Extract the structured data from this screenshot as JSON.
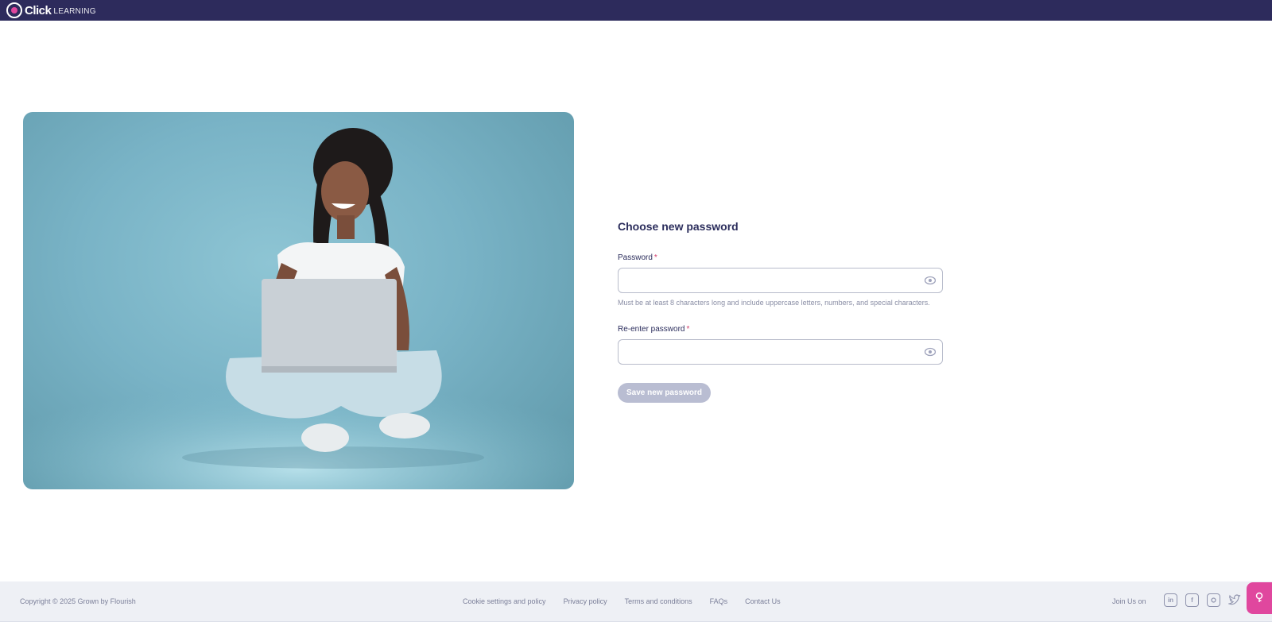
{
  "app": {
    "logo_brand": "Click",
    "logo_sub": "LEARNING"
  },
  "form": {
    "title": "Choose new password",
    "password_label": "Password",
    "password_required": "*",
    "password_value": "",
    "password_hint": "Must be at least 8 characters long and include uppercase letters, numbers, and special characters.",
    "reenter_label": "Re-enter password",
    "reenter_required": "*",
    "reenter_value": "",
    "save_label": "Save new password",
    "save_disabled": true
  },
  "footer": {
    "copyright": "Copyright © 2025 Grown by Flourish",
    "links": [
      "Cookie settings and policy",
      "Privacy policy",
      "Terms and conditions",
      "FAQs",
      "Contact Us"
    ],
    "join_label": "Join Us on",
    "socials": [
      "linkedin-icon",
      "facebook-icon",
      "instagram-icon",
      "twitter-icon"
    ]
  },
  "colors": {
    "topbar": "#2d2b5c",
    "accent_pink": "#e0479e",
    "button_disabled": "#b9bdd2",
    "footer_bg": "#eef0f5"
  },
  "icons": {
    "eye": "eye-icon",
    "help": "help-icon"
  }
}
